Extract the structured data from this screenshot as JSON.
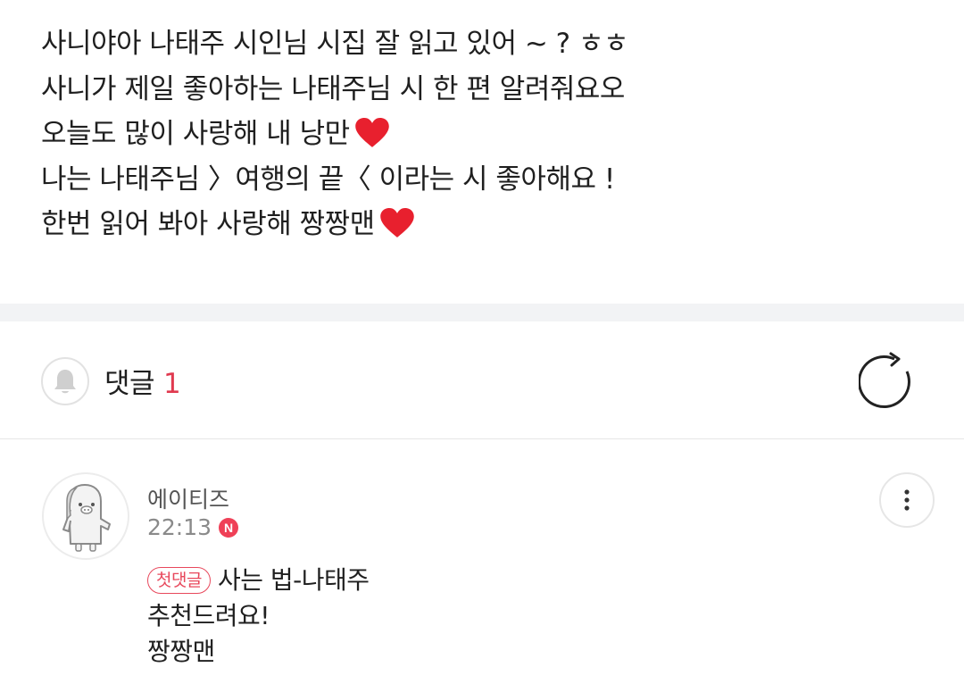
{
  "post": {
    "lines": [
      "사니야아 나태주 시인님 시집 잘 읽고 있어 ~ ? ㅎㅎ",
      "사니가 제일 좋아하는 나태주님 시 한 편 알려줘요오",
      "오늘도 많이 사랑해 내 낭만",
      "나는 나태주님 〉여행의 끝〈 이라는 시 좋아해요 !",
      "한번 읽어 봐아 사랑해 짱짱맨"
    ],
    "heart_color": "#e8202e"
  },
  "comments_section": {
    "title": "댓글",
    "count": "1",
    "bell_icon": "bell-icon",
    "refresh_icon": "refresh-icon",
    "accent_color": "#e0394f"
  },
  "comment": {
    "author": "에이티즈",
    "time": "22:13",
    "new_badge": "N",
    "first_badge": "첫댓글",
    "lines": [
      "사는 법-나태주",
      "추천드려요!",
      "짱짱맨"
    ],
    "more_icon": "more-vertical-icon"
  }
}
